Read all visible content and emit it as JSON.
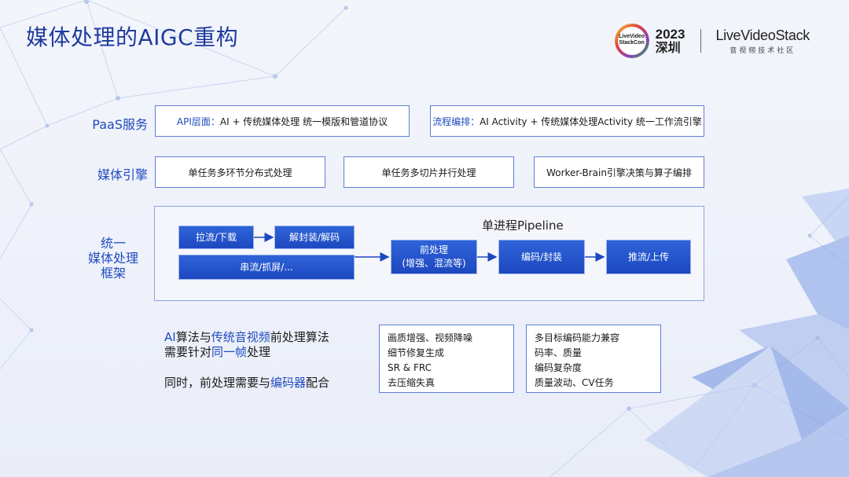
{
  "title": "媒体处理的AIGC重构",
  "logo": {
    "badge_line1": "LiveVideo",
    "badge_line2": "StackCon",
    "year": "2023",
    "city": "深圳",
    "brand": "LiveVideoStack",
    "brand_sub": "音视频技术社区"
  },
  "paas": {
    "label": "PaaS服务",
    "api_prefix": "API层面：",
    "api_text": "AI + 传统媒体处理 统一模版和管道协议",
    "flow_prefix": "流程编排：",
    "flow_text": "AI Activity + 传统媒体处理Activity 统一工作流引擎"
  },
  "engine": {
    "label": "媒体引擎",
    "items": [
      "单任务多环节分布式处理",
      "单任务多切片并行处理",
      "Worker-Brain引擎决策与算子编排"
    ]
  },
  "framework": {
    "label_line1": "统一",
    "label_line2": "媒体处理",
    "label_line3": "框架",
    "pipeline_title": "单进程Pipeline",
    "pull": "拉流/下载",
    "demux": "解封装/解码",
    "stream": "串流/抓屏/...",
    "pre_line1": "前处理",
    "pre_line2": "(增强、混流等)",
    "encode": "编码/封装",
    "push": "推流/上传"
  },
  "notes": {
    "p1_a": "AI",
    "p1_b": "算法与",
    "p1_c": "传统音视频",
    "p1_d": "前处理算法",
    "p2_a": "需要针对",
    "p2_b": "同一帧",
    "p2_c": "处理",
    "p3_a": "同时，前处理需要与",
    "p3_b": "编码器",
    "p3_c": "配合"
  },
  "list_left": [
    "画质增强、视频降噪",
    "细节修复生成",
    "SR & FRC",
    "去压缩失真"
  ],
  "list_right": [
    "多目标编码能力兼容",
    "码率、质量",
    "编码复杂度",
    "质量波动、CV任务"
  ],
  "colors": {
    "accent": "#1f4bbf",
    "box_blue": "#2f63d8",
    "border": "#5b7fd6"
  }
}
